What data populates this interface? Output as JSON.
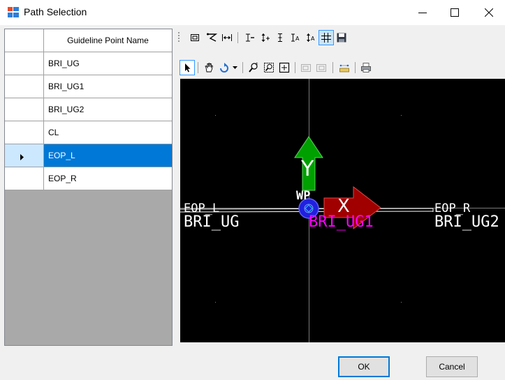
{
  "window": {
    "title": "Path Selection",
    "icon": "app-icon",
    "controls": [
      "minimize-icon",
      "maximize-icon",
      "close-icon"
    ]
  },
  "grid": {
    "column_header": "Guideline Point Name",
    "rows": [
      "BRI_UG",
      "BRI_UG1",
      "BRI_UG2",
      "CL",
      "EOP_L",
      "EOP_R"
    ],
    "selected_row": "EOP_L"
  },
  "toolbar_top": {
    "buttons": [
      "frame-icon",
      "perspective-icon",
      "fit-width-icon",
      "x-axis-icon",
      "y-axis-plus-icon",
      "y-axis-icon",
      "x-axis-auto-icon",
      "y-axis-auto-icon",
      "grid-icon",
      "save-icon"
    ],
    "checked": "grid-icon"
  },
  "toolbar_bottom": {
    "buttons": [
      "select-arrow-icon",
      "pan-hand-icon",
      "rotate-icon",
      "dropdown-arrow-icon",
      "zoom-icon",
      "zoom-region-icon",
      "zoom-extents-icon",
      "previous-view-icon",
      "next-view-icon",
      "measure-icon",
      "print-icon"
    ],
    "pressed": "select-arrow-icon"
  },
  "viewport": {
    "background": "#000000",
    "axis_y_label": "Y",
    "axis_x_label": "X",
    "origin_label": "WP",
    "labels": {
      "left": "BRI_UG",
      "left_overlap": "EOP_L",
      "center": "BRI_UG1",
      "right": "BRI_UG2",
      "right_overlap": "EOP_R"
    },
    "colors": {
      "y_arrow": "#00a000",
      "x_arrow": "#a00000",
      "origin": "#3030ff",
      "center_label": "#ff00ff",
      "labels": "#ffffff"
    }
  },
  "buttons": {
    "ok": "OK",
    "cancel": "Cancel"
  }
}
